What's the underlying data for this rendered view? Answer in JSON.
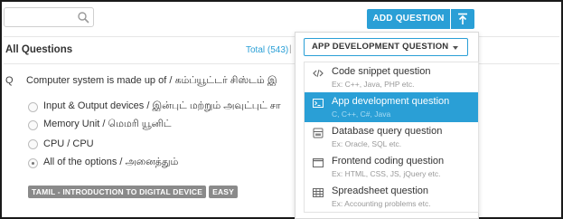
{
  "search": {
    "value": "",
    "placeholder": ""
  },
  "header": {
    "title": "All Questions",
    "total_label": "Total (543)",
    "separator": "|"
  },
  "question": {
    "number": "Q",
    "text": "Computer system is made up of / கம்ப்யூட்டர் சிஸ்டம் இ",
    "options": [
      {
        "label": "Input & Output devices / இன்புட் மற்றும் அவுட்புட் சா",
        "selected": false
      },
      {
        "label": "Memory Unit / மெமரி யூனிட்",
        "selected": false
      },
      {
        "label": "CPU / CPU",
        "selected": false
      },
      {
        "label": "All of the options / அனைத்தும்",
        "selected": true
      }
    ],
    "tags": [
      "TAMIL - INTRODUCTION TO DIGITAL DEVICE",
      "EASY"
    ]
  },
  "toolbar": {
    "add_question_label": "ADD QUESTION",
    "upload_icon": "upload-icon"
  },
  "dropdown": {
    "selected": "APP DEVELOPMENT QUESTION",
    "items": [
      {
        "title": "Code snippet question",
        "subtitle": "Ex: C++, Java, PHP etc.",
        "icon": "code-icon",
        "active": false
      },
      {
        "title": "App development question",
        "subtitle": "C, C++, C#, Java",
        "icon": "terminal-icon",
        "active": true
      },
      {
        "title": "Database query question",
        "subtitle": "Ex: Oracle, SQL etc.",
        "icon": "database-icon",
        "active": false
      },
      {
        "title": "Frontend coding question",
        "subtitle": "Ex: HTML, CSS, JS, jQuery etc.",
        "icon": "window-icon",
        "active": false
      },
      {
        "title": "Spreadsheet question",
        "subtitle": "Ex: Accounting problems etc.",
        "icon": "spreadsheet-icon",
        "active": false
      }
    ]
  },
  "colors": {
    "accent": "#2a9fd6",
    "tag": "#8a8a8a"
  }
}
